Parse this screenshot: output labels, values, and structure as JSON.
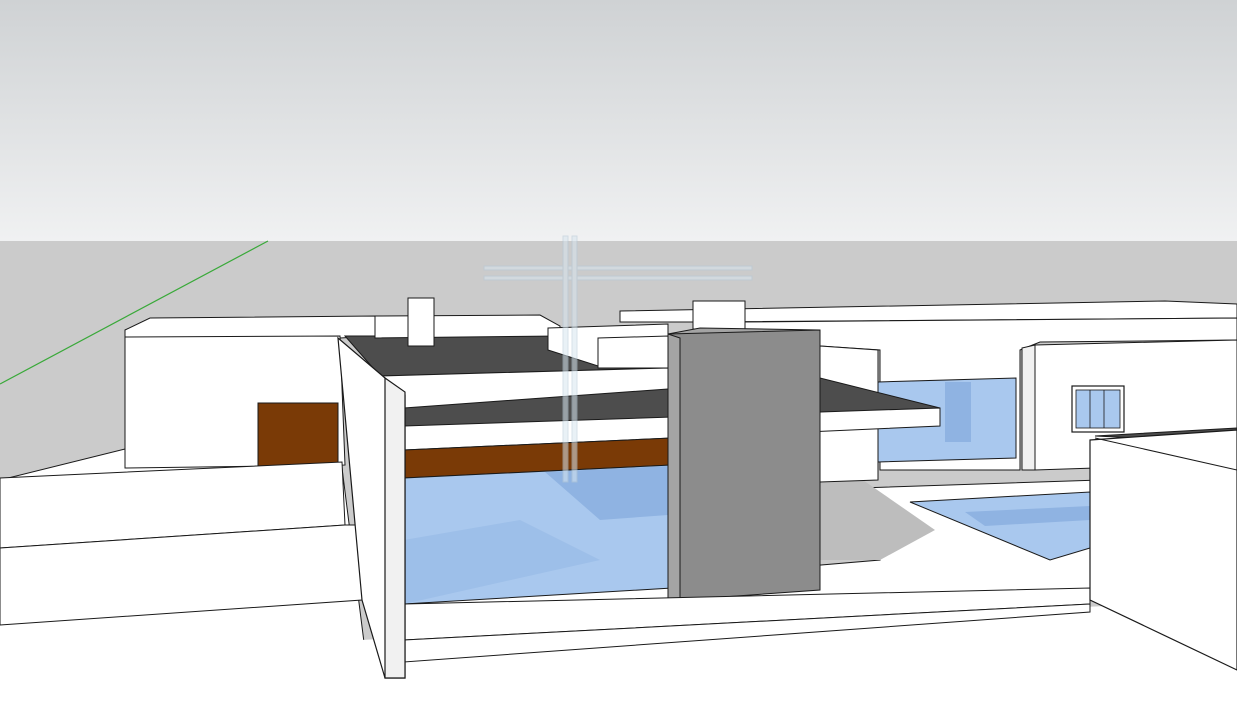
{
  "app": {
    "view": "3d-model-viewport",
    "visible_text": []
  },
  "colors": {
    "sky_top": "#cfd2d4",
    "sky_bottom": "#f0f1f2",
    "ground": "#cbcbcb",
    "wall_white": "#ffffff",
    "wall_shade": "#f1f1f1",
    "edge": "#1a1a1a",
    "roof_dark": "#4d4d4d",
    "column_gray": "#8c8c8c",
    "column_top": "#a4a4a4",
    "wood": "#7a3a06",
    "glass": "#a9c8ee",
    "glass_dark": "#8fb3e2",
    "shadow": "#bdbdbd",
    "axis_green": "#39a939"
  },
  "axes": {
    "green_axis_visible": true
  },
  "model": {
    "objects": [
      "perimeter-wall-left",
      "house-block-left",
      "wood-door",
      "chimney-left",
      "chimney-right",
      "flat-roof-dark",
      "cantilever-canopy",
      "wood-beam",
      "glass-facade",
      "gray-column",
      "house-wing-right",
      "window-right",
      "pool",
      "wall-right-front",
      "selection-gizmo"
    ]
  }
}
